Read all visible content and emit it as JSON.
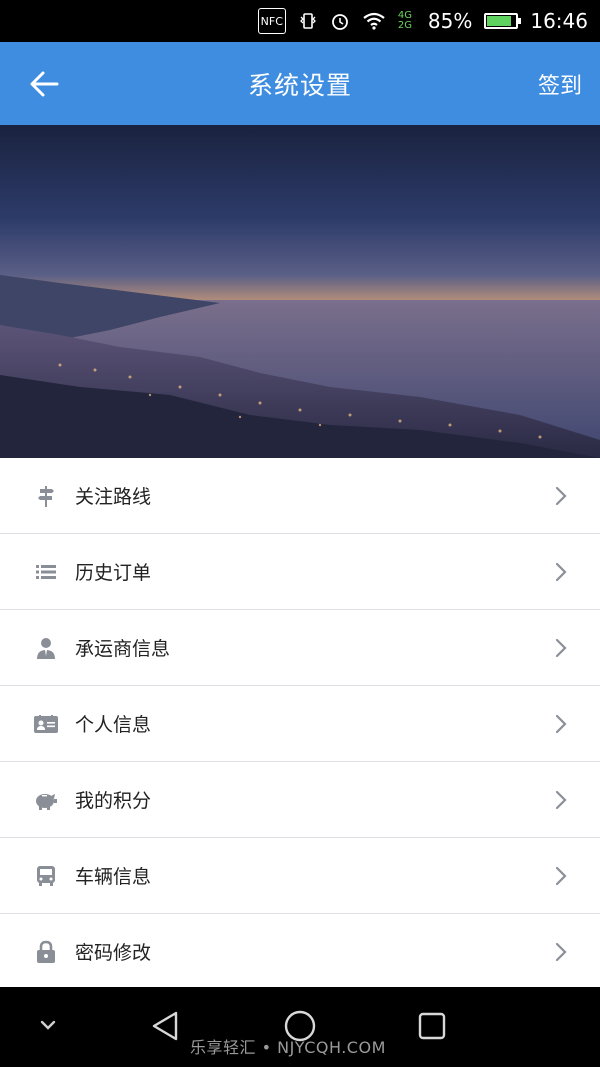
{
  "status_bar": {
    "nfc": "NFC",
    "network": "4G 2G",
    "battery": "85%",
    "time": "16:46"
  },
  "app_bar": {
    "title": "系统设置",
    "action": "签到"
  },
  "menu": [
    {
      "label": "关注路线",
      "icon": "signpost-icon"
    },
    {
      "label": "历史订单",
      "icon": "list-icon"
    },
    {
      "label": "承运商信息",
      "icon": "person-icon"
    },
    {
      "label": "个人信息",
      "icon": "id-card-icon"
    },
    {
      "label": "我的积分",
      "icon": "piggy-bank-icon"
    },
    {
      "label": "车辆信息",
      "icon": "bus-icon"
    },
    {
      "label": "密码修改",
      "icon": "lock-icon"
    }
  ],
  "watermark": "乐享轻汇 • NJYCQH.COM",
  "colors": {
    "app_bar": "#3f8de0",
    "icon_gray": "#8a8f97"
  }
}
